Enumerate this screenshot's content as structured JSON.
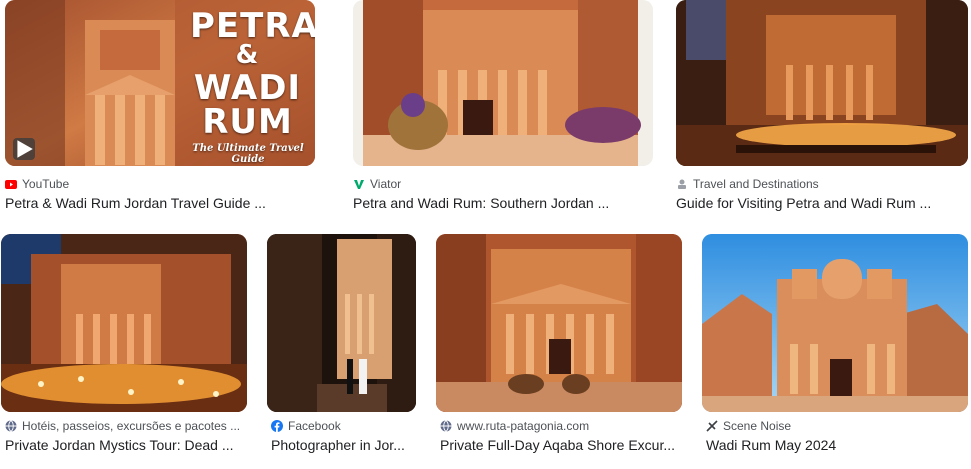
{
  "results": [
    {
      "source": "YouTube",
      "title": "Petra & Wadi Rum Jordan Travel Guide ...",
      "source_icon": "youtube-icon",
      "icon_color": "#ff0000"
    },
    {
      "source": "Viator",
      "title": "Petra and Wadi Rum: Southern Jordan ...",
      "source_icon": "viator-icon",
      "icon_color": "#00aa6c"
    },
    {
      "source": "Travel and Destinations",
      "title": "Guide for Visiting Petra and Wadi Rum ...",
      "source_icon": "travel-destinations-icon",
      "icon_color": "#9aa0a6"
    },
    {
      "source": "Hotéis, passeios, excursões e pacotes ...",
      "title": "Private Jordan Mystics Tour: Dead ...",
      "source_icon": "globe-icon",
      "icon_color": "#5f6a8a"
    },
    {
      "source": "Facebook",
      "title": "Photographer in Jor...",
      "source_icon": "facebook-icon",
      "icon_color": "#1877f2"
    },
    {
      "source": "www.ruta-patagonia.com",
      "title": "Private Full-Day Aqaba Shore Excur...",
      "source_icon": "globe-icon",
      "icon_color": "#5f6a8a"
    },
    {
      "source": "Scene Noise",
      "title": "Wadi Rum May 2024",
      "source_icon": "scene-noise-icon",
      "icon_color": "#3c4043"
    }
  ],
  "thumb1_overlay": {
    "line1": "PETRA",
    "line2": "&",
    "line3": "WADI",
    "line4": "RUM",
    "subtitle": "The Ultimate Travel Guide"
  }
}
